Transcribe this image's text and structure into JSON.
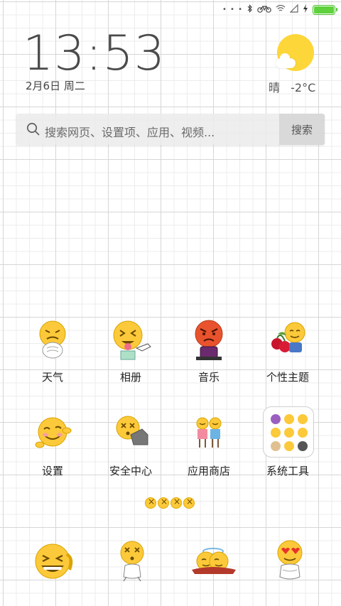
{
  "status_bar": {
    "signal_dots": "• • •",
    "icons": [
      "bluetooth-icon",
      "bike-icon",
      "wifi-icon",
      "signal-icon",
      "charging-icon"
    ],
    "battery_level": 1.0
  },
  "clock": {
    "time": "13:53",
    "date": "2月6日 周二"
  },
  "weather": {
    "condition": "晴",
    "temperature": "-2°C"
  },
  "search": {
    "placeholder": "搜索网页、设置项、应用、视频...",
    "button_label": "搜索"
  },
  "apps": [
    {
      "label": "天气",
      "icon": "weather-emoji-icon"
    },
    {
      "label": "相册",
      "icon": "gallery-emoji-icon"
    },
    {
      "label": "音乐",
      "icon": "music-emoji-icon"
    },
    {
      "label": "个性主题",
      "icon": "themes-emoji-icon"
    },
    {
      "label": "设置",
      "icon": "settings-emoji-icon"
    },
    {
      "label": "安全中心",
      "icon": "security-emoji-icon"
    },
    {
      "label": "应用商店",
      "icon": "app-store-emoji-icon"
    },
    {
      "label": "系统工具",
      "icon": "system-tools-folder-icon"
    }
  ],
  "page_indicator": {
    "pages": 4
  },
  "dock": [
    {
      "icon": "laughing-emoji-icon"
    },
    {
      "icon": "dizzy-emoji-icon"
    },
    {
      "icon": "angel-emoji-icon"
    },
    {
      "icon": "heart-eyes-emoji-icon"
    }
  ],
  "colors": {
    "emoji_yellow": "#fcc93a",
    "angry_red": "#e8532d",
    "battery_green": "#5fd13c",
    "sun": "#fdd63a"
  }
}
